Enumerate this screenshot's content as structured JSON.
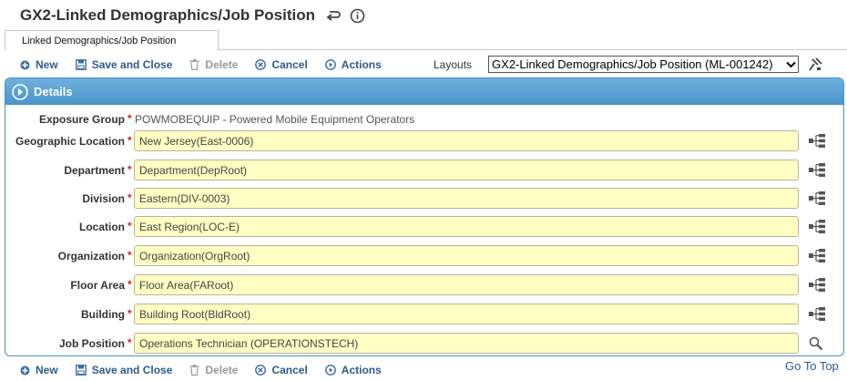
{
  "page": {
    "title": "GX2-Linked Demographics/Job Position"
  },
  "tabs": [
    {
      "label": "Linked Demographics/Job Position"
    }
  ],
  "toolbar": {
    "new_label": "New",
    "save_close_label": "Save and Close",
    "delete_label": "Delete",
    "cancel_label": "Cancel",
    "actions_label": "Actions"
  },
  "layouts": {
    "label": "Layouts",
    "selected": "GX2-Linked Demographics/Job Position (ML-001242)"
  },
  "panel": {
    "title": "Details"
  },
  "fields": {
    "exposure_group": {
      "label": "Exposure Group",
      "value": "POWMOBEQUIP - Powered Mobile Equipment Operators"
    },
    "geographic_location": {
      "label": "Geographic Location",
      "value": "New Jersey(East-0006)"
    },
    "department": {
      "label": "Department",
      "value": "Department(DepRoot)"
    },
    "division": {
      "label": "Division",
      "value": "Eastern(DIV-0003)"
    },
    "location": {
      "label": "Location",
      "value": "East Region(LOC-E)"
    },
    "organization": {
      "label": "Organization",
      "value": "Organization(OrgRoot)"
    },
    "floor_area": {
      "label": "Floor Area",
      "value": "Floor Area(FARoot)"
    },
    "building": {
      "label": "Building",
      "value": "Building Root(BldRoot)"
    },
    "job_position": {
      "label": "Job Position",
      "value": "Operations Technician (OPERATIONSTECH)"
    }
  },
  "required_marker": "*",
  "footer": {
    "goto_top": "Go To Top"
  },
  "colors": {
    "link": "#2d5c8a",
    "panel_header": "#4b94cb",
    "field_bg": "#ffffc4",
    "required": "#d42424"
  }
}
